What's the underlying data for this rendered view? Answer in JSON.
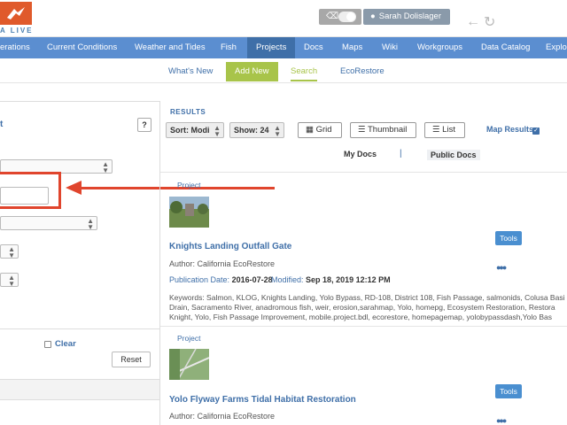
{
  "header": {
    "logo_text": "A LIVE",
    "user_name": "Sarah Dolislager"
  },
  "mainnav": {
    "items": [
      "erations",
      "Current Conditions",
      "Weather and Tides",
      "Fish",
      "Projects",
      "Docs",
      "Maps",
      "Wiki",
      "Workgroups",
      "Data Catalog",
      "Explo"
    ]
  },
  "subnav": {
    "items": [
      "What's New",
      "Add New",
      "Search",
      "EcoRestore"
    ]
  },
  "left": {
    "title_fragment": "t",
    "help": "?",
    "clear": "Clear",
    "reset": "Reset"
  },
  "results": {
    "label": "RESULTS",
    "sort": "Sort: Modi",
    "show": "Show: 24",
    "views": [
      "Grid",
      "Thumbnail",
      "List"
    ],
    "map_results": "Map Results",
    "tabs": [
      "My Docs",
      "Public Docs"
    ],
    "tab_sep": "|",
    "cards": [
      {
        "type": "Project",
        "title": "Knights Landing Outfall Gate",
        "author": "Author: California EcoRestore",
        "pub_label": "Publication Date:",
        "pub_date": "2016-07-28",
        "mod_label": "Modified:",
        "mod_date": "Sep 18, 2019 12:12 PM",
        "keywords_1": "Keywords: Salmon, KLOG, Knights Landing, Yolo Bypass, RD-108, District 108, Fish Passage, salmonids, Colusa Basi",
        "keywords_2": "Drain, Sacramento River, anadromous fish, weir, erosion,sarahmap, Yolo, homepg, Ecosystem Restoration, Restora",
        "keywords_3": "Knight, Yolo, Fish Passage Improvement, mobile.project.bdl, ecorestore, homepagemap, yolobypassdash,Yolo Bas",
        "tools": "Tools"
      },
      {
        "type": "Project",
        "title": "Yolo Flyway Farms Tidal Habitat Restoration",
        "author": "Author: California EcoRestore",
        "tools": "Tools"
      }
    ]
  },
  "colors": {
    "nav_blue": "#5b8ed0",
    "nav_active": "#3f6fa8",
    "accent_green": "#a8c44a",
    "callout_red": "#e0452d",
    "logo_orange": "#e05a2b"
  }
}
